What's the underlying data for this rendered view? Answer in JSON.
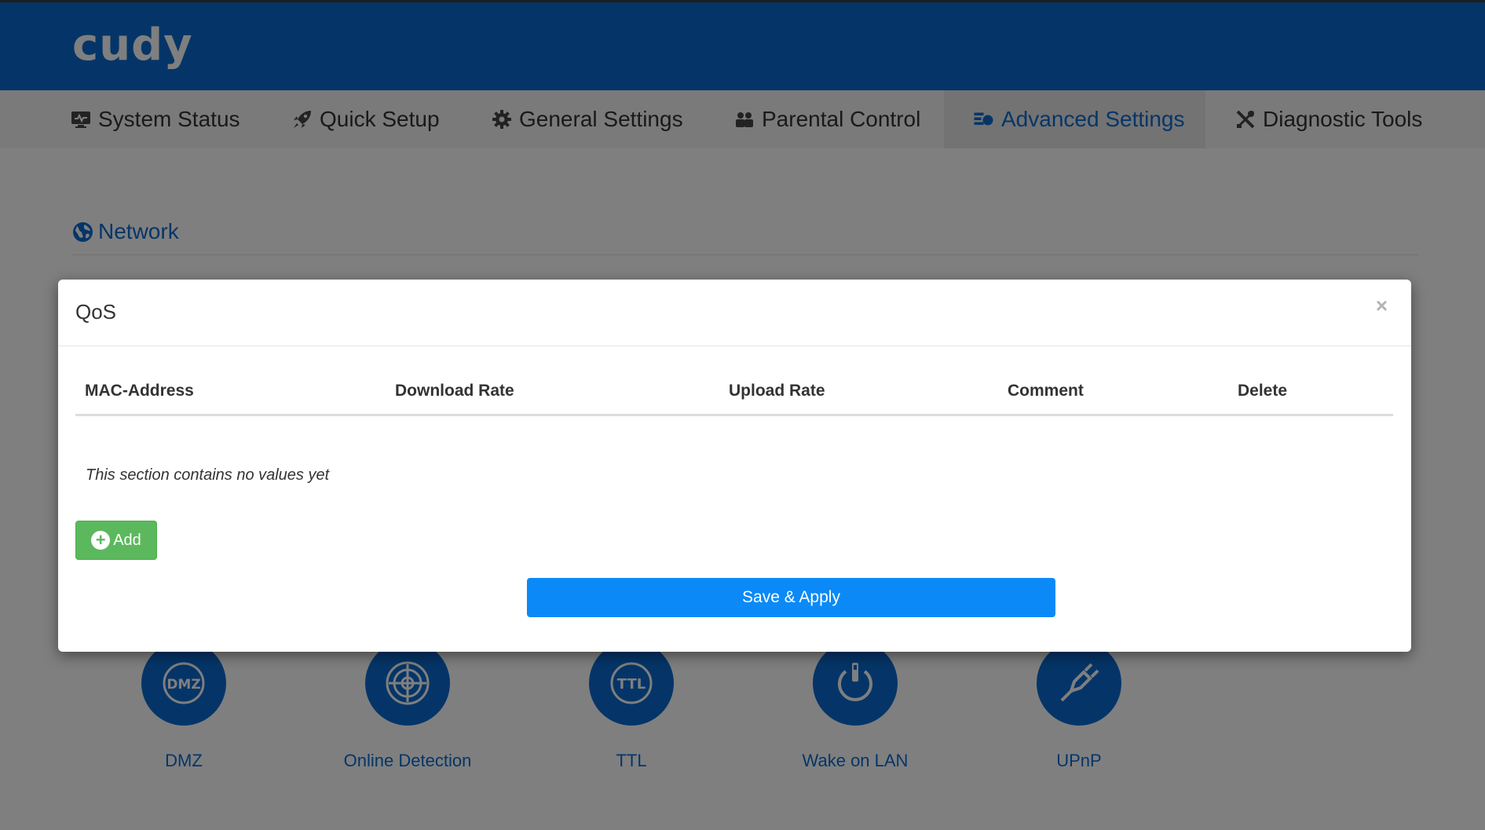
{
  "header": {
    "logo": "cudy"
  },
  "nav": [
    {
      "label": "System Status",
      "icon": "monitor-icon"
    },
    {
      "label": "Quick Setup",
      "icon": "rocket-icon"
    },
    {
      "label": "General Settings",
      "icon": "gear-icon"
    },
    {
      "label": "Parental Control",
      "icon": "users-icon"
    },
    {
      "label": "Advanced Settings",
      "icon": "sliders-gear-icon",
      "active": true
    },
    {
      "label": "Diagnostic Tools",
      "icon": "tools-icon"
    }
  ],
  "section": {
    "title": "Network",
    "icon": "globe-icon"
  },
  "tiles": [
    {
      "label": "DMZ",
      "icon": "dmz-icon",
      "badge": "DMZ"
    },
    {
      "label": "Online Detection",
      "icon": "radar-icon"
    },
    {
      "label": "TTL",
      "icon": "ttl-icon",
      "badge": "TTL"
    },
    {
      "label": "Wake on LAN",
      "icon": "power-icon"
    },
    {
      "label": "UPnP",
      "icon": "plug-icon"
    }
  ],
  "modal": {
    "title": "QoS",
    "close": "×",
    "columns": [
      "MAC-Address",
      "Download Rate",
      "Upload Rate",
      "Comment",
      "Delete"
    ],
    "empty_message": "This section contains no values yet",
    "add_label": "Add",
    "save_label": "Save & Apply"
  },
  "colors": {
    "brand_blue": "#0b6bd1",
    "save_blue": "#0b8af7",
    "add_green": "#5cb85c"
  }
}
